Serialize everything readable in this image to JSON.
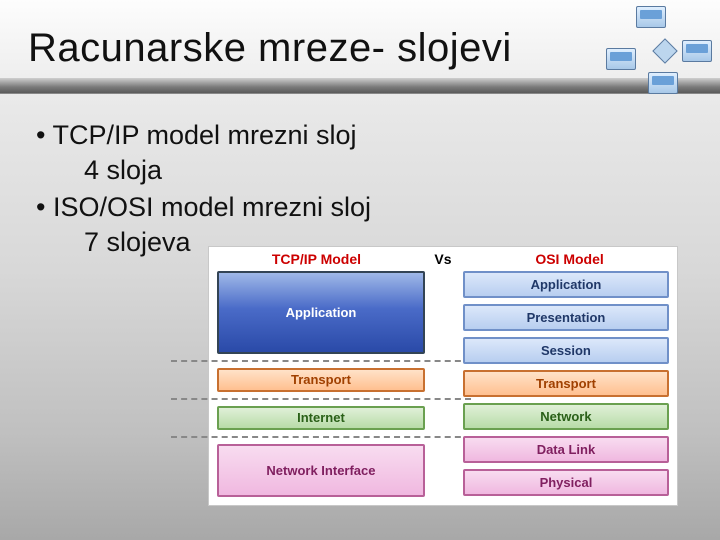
{
  "title": "Racunarske mreze- slojevi",
  "bullets": {
    "b1": "• TCP/IP model  mrezni sloj",
    "b1sub": "4 sloja",
    "b2": "• ISO/OSI model mrezni  sloj",
    "b2sub": "7 slojeva"
  },
  "chart_data": {
    "type": "table",
    "title_left": "TCP/IP Model",
    "title_mid": "Vs",
    "title_right": "OSI Model",
    "tcpip_layers": [
      "Application",
      "Transport",
      "Internet",
      "Network Interface"
    ],
    "osi_layers": [
      "Application",
      "Presentation",
      "Session",
      "Transport",
      "Network",
      "Data Link",
      "Physical"
    ],
    "mapping": [
      {
        "tcpip": "Application",
        "osi": [
          "Application",
          "Presentation",
          "Session"
        ]
      },
      {
        "tcpip": "Transport",
        "osi": [
          "Transport"
        ]
      },
      {
        "tcpip": "Internet",
        "osi": [
          "Network"
        ]
      },
      {
        "tcpip": "Network Interface",
        "osi": [
          "Data Link",
          "Physical"
        ]
      }
    ]
  }
}
